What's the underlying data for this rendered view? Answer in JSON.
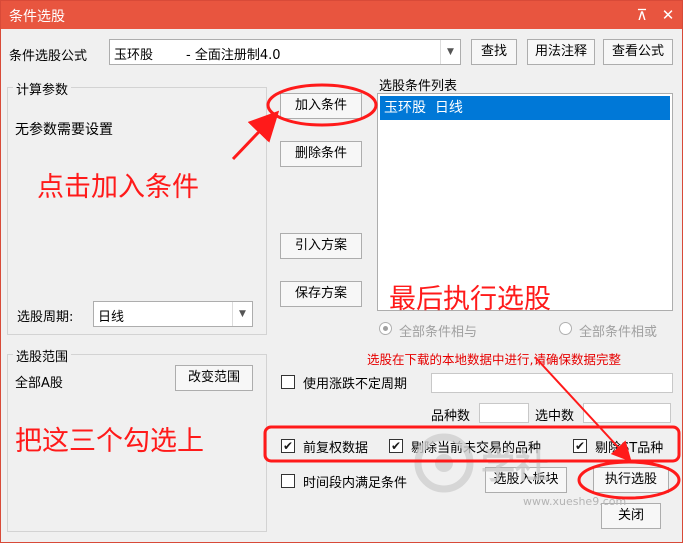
{
  "window": {
    "title": "条件选股",
    "pin_glyph": "⊼",
    "close_glyph": "✕"
  },
  "formula": {
    "label": "条件选股公式",
    "selected": "玉环股        - 全面注册制4.0",
    "find_button": "查找",
    "usage_button": "用法注释",
    "view_button": "查看公式"
  },
  "params": {
    "title": "计算参数",
    "text": "无参数需要设置"
  },
  "period": {
    "label": "选股周期:",
    "value": "日线"
  },
  "middle_buttons": {
    "add": "加入条件",
    "delete": "删除条件",
    "import": "引入方案",
    "save": "保存方案"
  },
  "condition_list": {
    "title": "选股条件列表",
    "items": [
      "玉环股  日线"
    ]
  },
  "logic": {
    "and_label": "全部条件相与",
    "or_label": "全部条件相或"
  },
  "notice": "选股在下载的本地数据中进行,请确保数据完整",
  "scope": {
    "title": "选股范围",
    "value": "全部A股",
    "change_button": "改变范围"
  },
  "options": {
    "use_limit_period": "使用涨跌不定周期",
    "count_label": "品种数",
    "selected_label": "选中数",
    "forward_adjust": "前复权数据",
    "exclude_nontrading": "剔除当前未交易的品种",
    "exclude_st": "剔除ST品种",
    "time_period": "时间段内满足条件"
  },
  "bottom_buttons": {
    "to_block": "选股入板块",
    "execute": "执行选股",
    "close": "关闭"
  },
  "annotations": {
    "click_add": "点击加入条件",
    "finally_execute": "最后执行选股",
    "check_three": "把这三个勾选上",
    "color": "#ff1a1a"
  },
  "watermark": {
    "brand": "学社",
    "url": "www.xueshe9.com"
  },
  "colors": {
    "title_bar": "#e8553f",
    "selection": "#0078d7",
    "annotation": "#ff1a1a"
  }
}
